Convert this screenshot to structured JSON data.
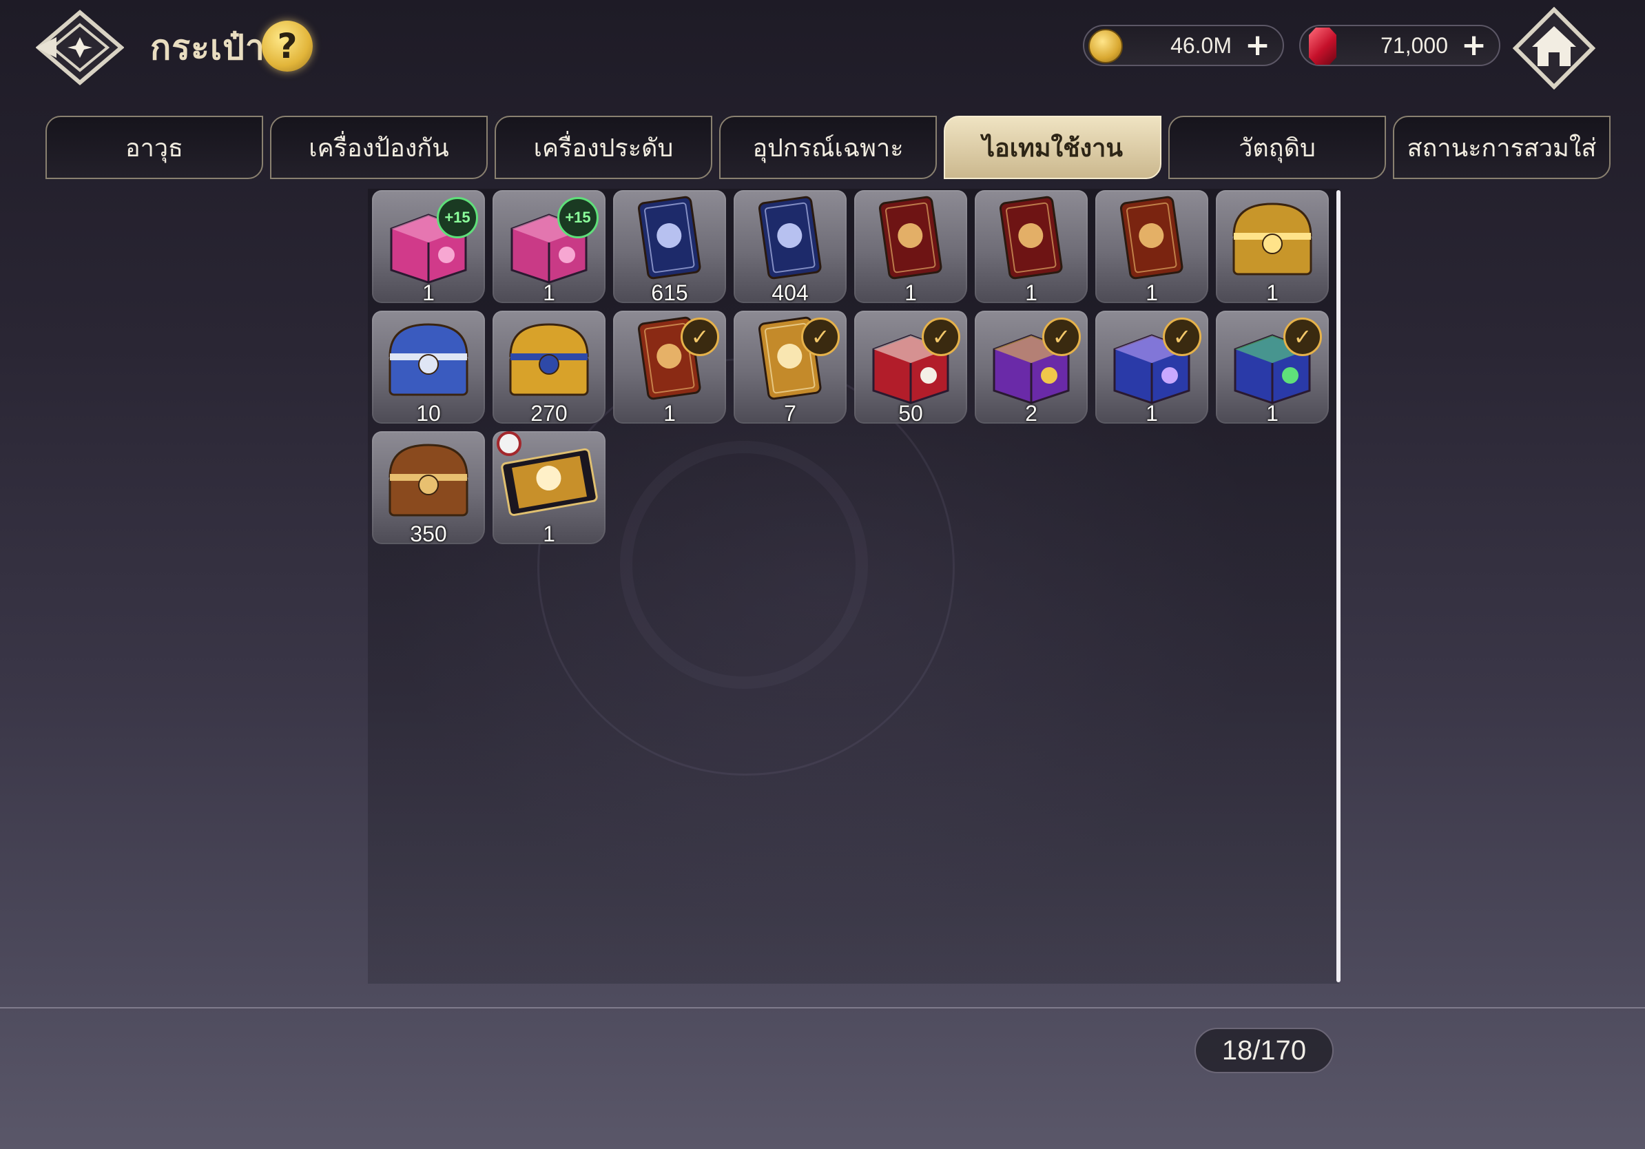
{
  "header": {
    "title": "กระเป๋า",
    "help_label": "?",
    "gold": {
      "icon": "gold-coin-icon",
      "value": "46.0M",
      "add": "+"
    },
    "gems": {
      "icon": "red-gem-icon",
      "value": "71,000",
      "add": "+"
    }
  },
  "tabs": [
    {
      "label": "อาวุธ",
      "active": false
    },
    {
      "label": "เครื่องป้องกัน",
      "active": false
    },
    {
      "label": "เครื่องประดับ",
      "active": false
    },
    {
      "label": "อุปกรณ์เฉพาะ",
      "active": false
    },
    {
      "label": "ไอเทมใช้งาน",
      "active": true
    },
    {
      "label": "วัตถุดิบ",
      "active": false
    },
    {
      "label": "สถานะการสวมใส่",
      "active": false
    }
  ],
  "inventory": {
    "items": [
      {
        "name": "weapon-box-plus15",
        "count": "1",
        "badge": "+15"
      },
      {
        "name": "armor-box-plus15",
        "count": "1",
        "badge": "+15"
      },
      {
        "name": "card-2star-blue",
        "count": "615"
      },
      {
        "name": "card-3star-blue",
        "count": "404"
      },
      {
        "name": "card-4star-red",
        "count": "1"
      },
      {
        "name": "card-6star-red",
        "count": "1"
      },
      {
        "name": "card-tier3-red",
        "count": "1"
      },
      {
        "name": "gold-chest",
        "count": "1"
      },
      {
        "name": "silver-blue-chest",
        "count": "10"
      },
      {
        "name": "gold-blue-chest",
        "count": "270"
      },
      {
        "name": "card-select-red",
        "count": "1"
      },
      {
        "name": "card-select-gold",
        "count": "7"
      },
      {
        "name": "card-pack-box",
        "count": "50"
      },
      {
        "name": "purple-gift-box",
        "count": "2"
      },
      {
        "name": "blue-gift-box",
        "count": "1"
      },
      {
        "name": "green-gift-box",
        "count": "1"
      },
      {
        "name": "wooden-key-chest",
        "count": "350"
      },
      {
        "name": "portrait-ticket",
        "count": "1"
      }
    ],
    "capacity": "18/170"
  },
  "colors": {
    "accent": "#e6b24a",
    "tab_active": "#efe3c2",
    "badge_green": "#5fe07a"
  }
}
